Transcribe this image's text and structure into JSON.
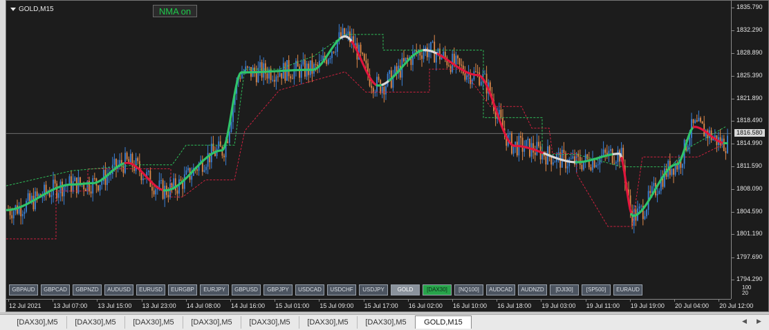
{
  "chart": {
    "symbol": "GOLD,M15",
    "indicator_button": "NMA on",
    "current_price": "1816.580",
    "zoom_label": "100\n20",
    "price_labels": [
      "1835.790",
      "1832.290",
      "1828.890",
      "1825.390",
      "1821.890",
      "1818.490",
      "1814.990",
      "1811.590",
      "1808.090",
      "1804.590",
      "1801.190",
      "1797.690",
      "1794.290"
    ],
    "time_labels": [
      "12 Jul 2021",
      "13 Jul 07:00",
      "13 Jul 15:00",
      "13 Jul 23:00",
      "14 Jul 08:00",
      "14 Jul 16:00",
      "15 Jul 01:00",
      "15 Jul 09:00",
      "15 Jul 17:00",
      "16 Jul 02:00",
      "16 Jul 10:00",
      "16 Jul 18:00",
      "19 Jul 03:00",
      "19 Jul 11:00",
      "19 Jul 19:00",
      "20 Jul 04:00",
      "20 Jul 12:00"
    ],
    "colors": {
      "background": "#1c1c1c",
      "bull": "#3b82d9",
      "bear": "#e08a4a",
      "nma_up": "#2fc46a",
      "nma_down": "#e0153c",
      "nma_flat": "#d8d8d8",
      "band_green": "#2fbf5a",
      "band_red": "#d0213f"
    }
  },
  "chart_data": {
    "type": "line",
    "title": "GOLD,M15",
    "ylim": [
      1794.29,
      1835.79
    ],
    "y_ticks": [
      1835.79,
      1832.29,
      1828.89,
      1825.39,
      1821.89,
      1818.49,
      1814.99,
      1811.59,
      1808.09,
      1804.59,
      1801.19,
      1797.69,
      1794.29
    ],
    "current_price": 1816.58,
    "x": [
      "12 Jul 2021",
      "13 Jul 07:00",
      "13 Jul 15:00",
      "13 Jul 23:00",
      "14 Jul 08:00",
      "14 Jul 16:00",
      "15 Jul 01:00",
      "15 Jul 09:00",
      "15 Jul 17:00",
      "16 Jul 02:00",
      "16 Jul 10:00",
      "16 Jul 18:00",
      "19 Jul 03:00",
      "19 Jul 11:00",
      "19 Jul 19:00",
      "20 Jul 04:00",
      "20 Jul 12:00"
    ],
    "series": [
      {
        "name": "NMA",
        "values": [
          1804.9,
          1808.8,
          1809.0,
          1812.1,
          1807.9,
          1814.0,
          1825.9,
          1826.3,
          1831.4,
          1823.9,
          1829.3,
          1825.5,
          1814.7,
          1812.2,
          1813.5,
          1804.0,
          1811.9,
          1817.6,
          1815.1
        ]
      }
    ]
  },
  "symbol_buttons": [
    "GBPAUD",
    "GBPCAD",
    "GBPNZD",
    "AUDUSD",
    "EURUSD",
    "EURGBP",
    "EURJPY",
    "GBPUSD",
    "GBPJPY",
    "USDCAD",
    "USDCHF",
    "USDJPY",
    "GOLD",
    "[DAX30]",
    "[NQ100]",
    "AUDCAD",
    "AUDNZD",
    "[DJI30]",
    "[SP500]",
    "EURAUD"
  ],
  "tabs": [
    "[DAX30],M5",
    "[DAX30],M5",
    "[DAX30],M5",
    "[DAX30],M5",
    "[DAX30],M5",
    "[DAX30],M5",
    "[DAX30],M5",
    "GOLD,M15"
  ],
  "tab_arrows": {
    "left": "◀",
    "right": "▶"
  }
}
